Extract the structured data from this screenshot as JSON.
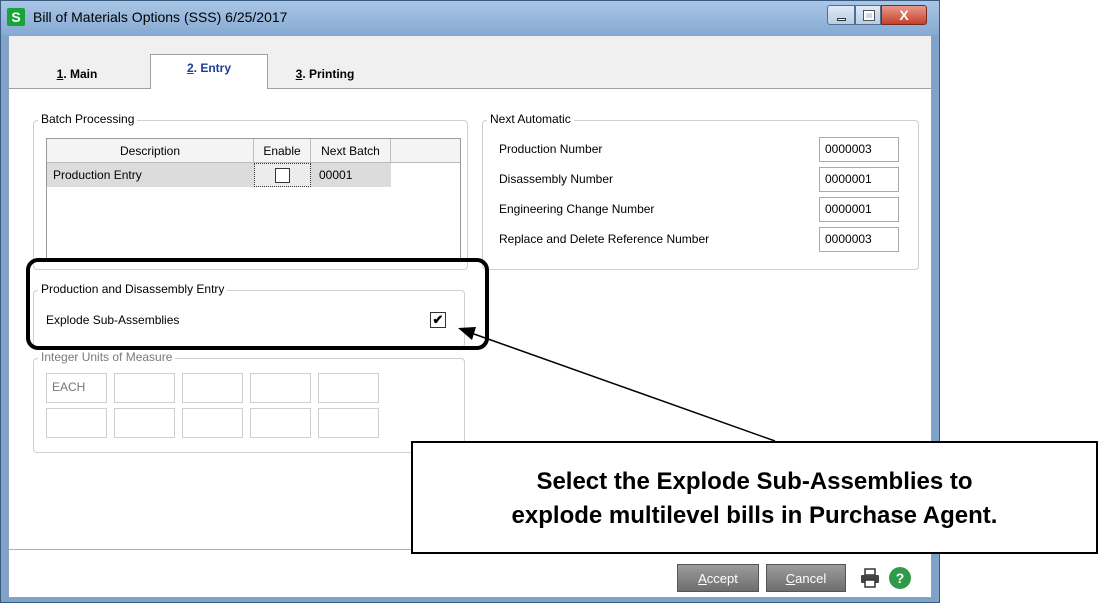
{
  "window": {
    "app_icon_letter": "S",
    "title": "Bill of Materials Options (SSS) 6/25/2017",
    "close_glyph": "X"
  },
  "tabs": [
    {
      "hotkey": "1",
      "label": ". Main"
    },
    {
      "hotkey": "2",
      "label": ". Entry"
    },
    {
      "hotkey": "3",
      "label": ". Printing"
    }
  ],
  "batch_processing": {
    "title": "Batch Processing",
    "columns": [
      "Description",
      "Enable",
      "Next Batch"
    ],
    "rows": [
      {
        "description": "Production Entry",
        "enable": false,
        "next_batch": "00001"
      }
    ]
  },
  "next_automatic": {
    "title": "Next Automatic",
    "fields": [
      {
        "label": "Production Number",
        "value": "0000003"
      },
      {
        "label": "Disassembly Number",
        "value": "0000001"
      },
      {
        "label": "Engineering Change Number",
        "value": "0000001"
      },
      {
        "label": "Replace and Delete Reference Number",
        "value": "0000003"
      }
    ]
  },
  "production_entry": {
    "title": "Production and Disassembly Entry",
    "explode_label": "Explode Sub-Assemblies",
    "explode_checked": true,
    "check_glyph": "✔"
  },
  "integer_uom": {
    "title": "Integer Units of Measure",
    "values": [
      "EACH",
      "",
      "",
      "",
      "",
      "",
      "",
      "",
      "",
      ""
    ]
  },
  "buttons": {
    "accept_hotkey": "A",
    "accept_rest": "ccept",
    "cancel_hotkey": "C",
    "cancel_rest": "ancel",
    "help_glyph": "?"
  },
  "callout": {
    "line1": "Select the Explode Sub-Assemblies to",
    "line2": "explode multilevel bills in Purchase Agent."
  },
  "icons": [
    "printer-icon",
    "help-icon"
  ]
}
